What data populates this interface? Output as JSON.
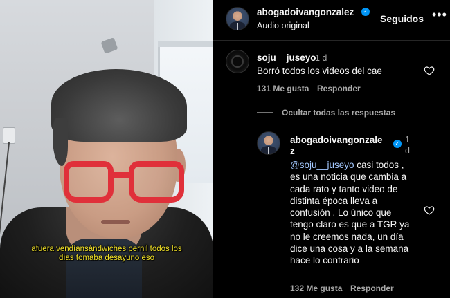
{
  "video": {
    "subtitle_line1": "afuera vendíansándwiches pernil   todos los",
    "subtitle_line2": "días tomaba desayuno eso"
  },
  "header": {
    "username": "abogadoivangonzalez",
    "audio": "Audio original",
    "follow_label": "Seguidos",
    "more_icon": "•••"
  },
  "comments": [
    {
      "username": "soju__juseyo",
      "time": "1 d",
      "text": "Borró todos los videos del cae",
      "likes": "131 Me gusta",
      "reply_label": "Responder"
    }
  ],
  "replies_toggle": "Ocultar todas las respuestas",
  "reply": {
    "username_part1": "abogadoivangonzale",
    "username_part2": "z",
    "time_part1": "1",
    "time_part2": "d",
    "mention": "@soju__juseyo",
    "lines": [
      " casi todos ,",
      "es una noticia que cambia a",
      "cada rato y tanto video de",
      "distinta época lleva a",
      "confusión . Lo único que",
      "tengo claro es que a TGR ya",
      "no le creemos nada, un día",
      "dice una cosa y a la semana",
      "hace lo contrario"
    ],
    "likes": "132 Me gusta",
    "reply_label": "Responder"
  },
  "colors": {
    "background": "#000000",
    "verified": "#0095f6",
    "mention": "#a3c8ff",
    "subtitle": "#f2e227",
    "secondary_text": "#a8a8a8"
  }
}
